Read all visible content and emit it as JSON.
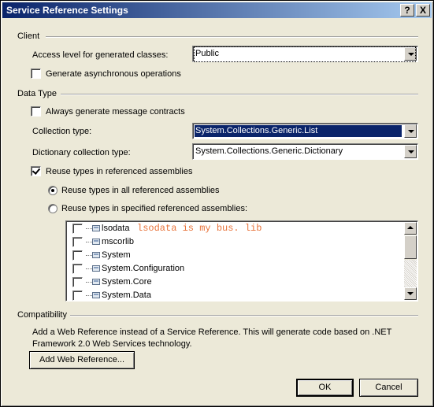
{
  "window": {
    "title": "Service Reference Settings",
    "help_button": "?",
    "close_button": "X"
  },
  "client": {
    "group_title": "Client",
    "access_level_label": "Access level for generated classes:",
    "access_level_value": "Public",
    "async_label": "Generate asynchronous operations",
    "async_checked": false
  },
  "data_type": {
    "group_title": "Data Type",
    "message_contracts_label": "Always generate message contracts",
    "message_contracts_checked": false,
    "collection_type_label": "Collection type:",
    "collection_type_value": "System.Collections.Generic.List",
    "dictionary_type_label": "Dictionary collection type:",
    "dictionary_type_value": "System.Collections.Generic.Dictionary",
    "reuse_types_label": "Reuse types in referenced assemblies",
    "reuse_types_checked": true,
    "reuse_all_label": "Reuse types in all referenced assemblies",
    "reuse_all_selected": true,
    "reuse_specified_label": "Reuse types in specified referenced assemblies:",
    "reuse_specified_selected": false,
    "assemblies": [
      {
        "name": "lsodata",
        "checked": false
      },
      {
        "name": "mscorlib",
        "checked": false
      },
      {
        "name": "System",
        "checked": false
      },
      {
        "name": "System.Configuration",
        "checked": false
      },
      {
        "name": "System.Core",
        "checked": false
      },
      {
        "name": "System.Data",
        "checked": false
      }
    ],
    "annotation": "lsodata is my bus. lib"
  },
  "compatibility": {
    "group_title": "Compatibility",
    "description": "Add a Web Reference instead of a Service Reference. This will generate code based on .NET Framework 2.0 Web Services technology.",
    "add_web_reference_label": "Add Web Reference..."
  },
  "footer": {
    "ok_label": "OK",
    "cancel_label": "Cancel"
  }
}
